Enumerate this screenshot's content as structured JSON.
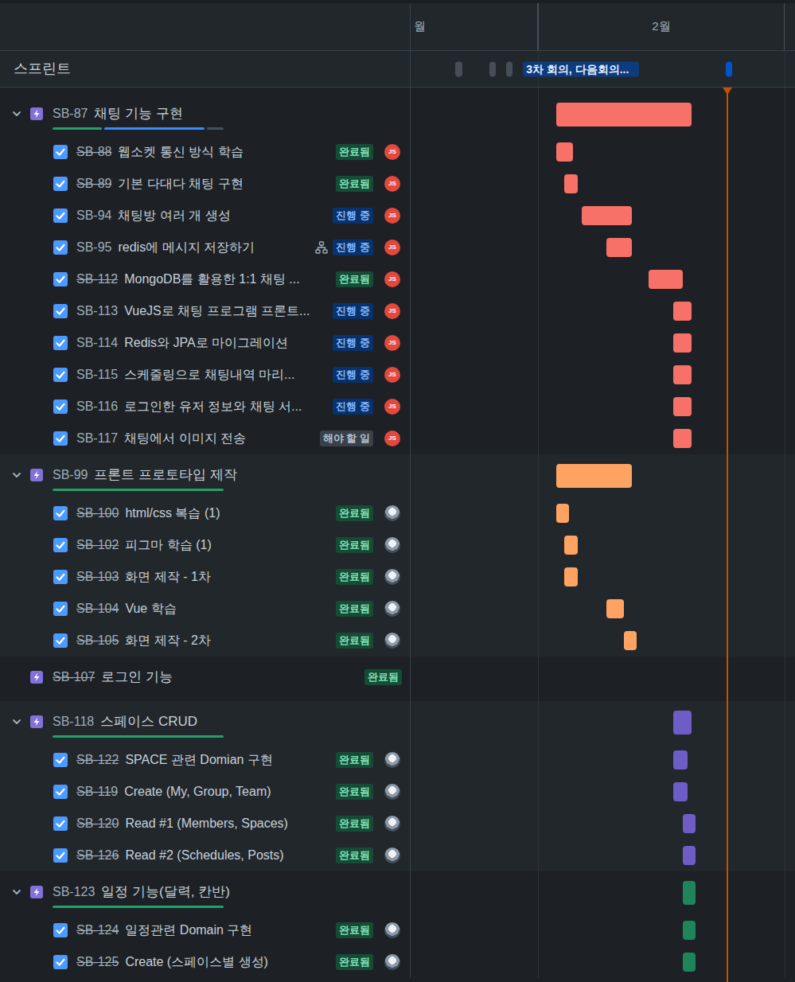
{
  "timeline": {
    "months": [
      {
        "label": "월",
        "start": -31,
        "end": 0
      },
      {
        "label": "2월",
        "start": 0,
        "end": 28
      }
    ],
    "today": 21.5
  },
  "sprints": {
    "label": "스프린트",
    "items": [
      {
        "start": -9.4,
        "end": -8.6,
        "color": "#454f59"
      },
      {
        "start": -5.5,
        "end": -4.8,
        "color": "#454f59"
      },
      {
        "start": -3.6,
        "end": -2.9,
        "color": "#454f59"
      },
      {
        "label": "3차 회의, 다음회의...",
        "start": -1.7,
        "end": 11.5,
        "color": "#0c3b7e"
      },
      {
        "start": 21.3,
        "end": 22,
        "color": "#0055cc"
      }
    ]
  },
  "epics": [
    {
      "key": "SB-87",
      "title": "채팅 기능 구현",
      "done": false,
      "expanded": true,
      "color": "#f87168",
      "progress": {
        "done": 0.3,
        "in_progress": 0.6
      },
      "bar": [
        2.1,
        17.4
      ],
      "issues": [
        {
          "key": "SB-88",
          "title": "웹소켓 통신 방식 학습",
          "category": "done",
          "status": "완료됨",
          "child_issues": false,
          "assignee": {
            "kind": "initials",
            "text": "JS"
          },
          "bar": [
            2.1,
            4
          ]
        },
        {
          "key": "SB-89",
          "title": "기본 다대다 채팅 구현",
          "category": "done",
          "status": "완료됨",
          "child_issues": false,
          "assignee": {
            "kind": "initials",
            "text": "JS"
          },
          "bar": [
            3,
            4.5
          ]
        },
        {
          "key": "SB-94",
          "title": "채팅방 여러 개 생성",
          "category": "inprogress",
          "status": "진행 중",
          "child_issues": false,
          "assignee": {
            "kind": "initials",
            "text": "JS"
          },
          "bar": [
            5,
            10.7
          ]
        },
        {
          "key": "SB-95",
          "title": "redis에 메시지 저장하기",
          "category": "inprogress",
          "status": "진행 중",
          "child_issues": true,
          "assignee": {
            "kind": "initials",
            "text": "JS"
          },
          "bar": [
            7.8,
            10.7
          ]
        },
        {
          "key": "SB-112",
          "title": "MongoDB를 활용한 1:1 채팅 ...",
          "category": "done",
          "status": "완료됨",
          "child_issues": false,
          "assignee": {
            "kind": "initials",
            "text": "JS"
          },
          "bar": [
            12.6,
            16.4
          ]
        },
        {
          "key": "SB-113",
          "title": "VueJS로 채팅 프로그램 프론트...",
          "category": "inprogress",
          "status": "진행 중",
          "child_issues": false,
          "assignee": {
            "kind": "initials",
            "text": "JS"
          },
          "bar": [
            15.4,
            17.4
          ]
        },
        {
          "key": "SB-114",
          "title": "Redis와 JPA로 마이그레이션",
          "category": "inprogress",
          "status": "진행 중",
          "child_issues": false,
          "assignee": {
            "kind": "initials",
            "text": "JS"
          },
          "bar": [
            15.4,
            17.4
          ]
        },
        {
          "key": "SB-115",
          "title": "스케줄링으로 채팅내역 마리...",
          "category": "inprogress",
          "status": "진행 중",
          "child_issues": false,
          "assignee": {
            "kind": "initials",
            "text": "JS"
          },
          "bar": [
            15.4,
            17.4
          ]
        },
        {
          "key": "SB-116",
          "title": "로그인한 유저 정보와 채팅 서...",
          "category": "inprogress",
          "status": "진행 중",
          "child_issues": false,
          "assignee": {
            "kind": "initials",
            "text": "JS"
          },
          "bar": [
            15.4,
            17.4
          ]
        },
        {
          "key": "SB-117",
          "title": "채팅에서 이미지 전송",
          "category": "todo",
          "status": "해야 할 일",
          "child_issues": false,
          "assignee": {
            "kind": "initials",
            "text": "JS"
          },
          "bar": [
            15.4,
            17.4
          ]
        }
      ]
    },
    {
      "key": "SB-99",
      "title": "프론트 프로토타입 제작",
      "done": false,
      "expanded": true,
      "color": "#fea362",
      "progress": {
        "done": 1,
        "in_progress": 0
      },
      "bar": [
        2.1,
        10.7
      ],
      "issues": [
        {
          "key": "SB-100",
          "title": "html/css 복습 (1)",
          "category": "done",
          "status": "완료됨",
          "child_issues": false,
          "assignee": {
            "kind": "photo"
          },
          "bar": [
            2.1,
            3.5
          ]
        },
        {
          "key": "SB-102",
          "title": "피그마 학습 (1)",
          "category": "done",
          "status": "완료됨",
          "child_issues": false,
          "assignee": {
            "kind": "photo"
          },
          "bar": [
            3,
            4.5
          ]
        },
        {
          "key": "SB-103",
          "title": "화면 제작 - 1차",
          "category": "done",
          "status": "완료됨",
          "child_issues": false,
          "assignee": {
            "kind": "photo"
          },
          "bar": [
            3,
            4.5
          ]
        },
        {
          "key": "SB-104",
          "title": "Vue 학습",
          "category": "done",
          "status": "완료됨",
          "child_issues": false,
          "assignee": {
            "kind": "photo"
          },
          "bar": [
            7.8,
            9.8
          ]
        },
        {
          "key": "SB-105",
          "title": "화면 제작 - 2차",
          "category": "done",
          "status": "완료됨",
          "child_issues": false,
          "assignee": {
            "kind": "photo"
          },
          "bar": [
            9.8,
            11.2
          ]
        }
      ]
    },
    {
      "key": "SB-107",
      "title": "로그인 기능",
      "done": true,
      "status": {
        "text": "완료됨",
        "category": "done"
      },
      "issues": []
    },
    {
      "key": "SB-118",
      "title": "스페이스 CRUD",
      "done": false,
      "expanded": true,
      "color": "#6e5dc6",
      "progress": {
        "done": 1,
        "in_progress": 0
      },
      "bar": [
        15.4,
        17.4
      ],
      "issues": [
        {
          "key": "SB-122",
          "title": "SPACE 관련 Domian 구현",
          "category": "done",
          "status": "완료됨",
          "child_issues": false,
          "assignee": {
            "kind": "photo"
          },
          "bar": [
            15.4,
            17
          ]
        },
        {
          "key": "SB-119",
          "title": "Create (My, Group, Team)",
          "category": "done",
          "status": "완료됨",
          "child_issues": false,
          "assignee": {
            "kind": "photo"
          },
          "bar": [
            15.4,
            17
          ]
        },
        {
          "key": "SB-120",
          "title": "Read #1 (Members, Spaces)",
          "category": "done",
          "status": "완료됨",
          "child_issues": false,
          "assignee": {
            "kind": "photo"
          },
          "bar": [
            16.4,
            17.9
          ]
        },
        {
          "key": "SB-126",
          "title": "Read #2 (Schedules, Posts)",
          "category": "done",
          "status": "완료됨",
          "child_issues": false,
          "assignee": {
            "kind": "photo"
          },
          "bar": [
            16.4,
            17.9
          ]
        }
      ]
    },
    {
      "key": "SB-123",
      "title": "일정 기능(달력, 칸반)",
      "done": false,
      "expanded": true,
      "color": "#1f845a",
      "progress": {
        "done": 1,
        "in_progress": 0
      },
      "bar": [
        16.4,
        17.9
      ],
      "issues": [
        {
          "key": "SB-124",
          "title": "일정관련 Domain 구현",
          "category": "done",
          "status": "완료됨",
          "child_issues": false,
          "assignee": {
            "kind": "photo"
          },
          "bar": [
            16.4,
            17.9
          ]
        },
        {
          "key": "SB-125",
          "title": "Create (스페이스별 생성)",
          "category": "done",
          "status": "완료됨",
          "child_issues": false,
          "assignee": {
            "kind": "photo"
          },
          "bar": [
            16.4,
            17.9
          ]
        }
      ]
    }
  ]
}
